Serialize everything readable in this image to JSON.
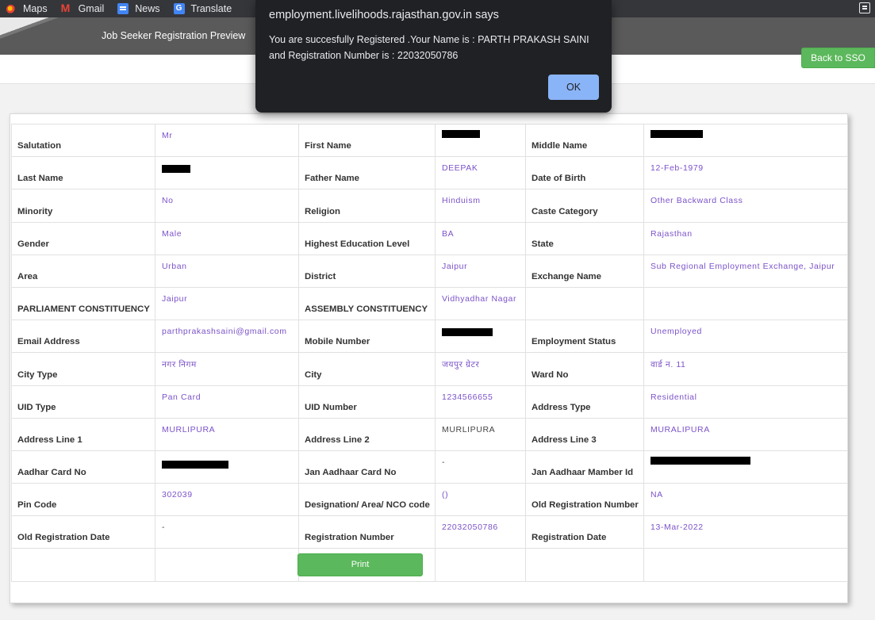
{
  "bookmarks": [
    {
      "label": "Maps",
      "icon": "maps-icon"
    },
    {
      "label": "Gmail",
      "icon": "gmail-icon"
    },
    {
      "label": "News",
      "icon": "news-icon"
    },
    {
      "label": "Translate",
      "icon": "translate-icon"
    }
  ],
  "header": {
    "title": "Job Seeker Registration Preview",
    "back_button": "Back to SSO"
  },
  "dialog": {
    "title": "employment.livelihoods.rajasthan.gov.in says",
    "message": "You are succesfully Registered .Your Name is  : PARTH PRAKASH SAINI\nand Registration Number is : 22032050786",
    "ok_label": "OK"
  },
  "form": {
    "rows": [
      [
        {
          "label": "Salutation",
          "value": "Mr"
        },
        {
          "label": "First Name",
          "value": "",
          "redacted": true
        },
        {
          "label": "Middle Name",
          "value": "",
          "redacted": true
        }
      ],
      [
        {
          "label": "Last Name",
          "value": "",
          "redacted": true
        },
        {
          "label": "Father Name",
          "value": "DEEPAK"
        },
        {
          "label": "Date of Birth",
          "value": "12-Feb-1979"
        }
      ],
      [
        {
          "label": "Minority",
          "value": "No"
        },
        {
          "label": "Religion",
          "value": "Hinduism"
        },
        {
          "label": "Caste Category",
          "value": "Other Backward Class"
        }
      ],
      [
        {
          "label": "Gender",
          "value": "Male"
        },
        {
          "label": "Highest Education Level",
          "value": "BA"
        },
        {
          "label": "State",
          "value": "Rajasthan"
        }
      ],
      [
        {
          "label": "Area",
          "value": "Urban"
        },
        {
          "label": "District",
          "value": "Jaipur"
        },
        {
          "label": "Exchange Name",
          "value": "Sub Regional Employment Exchange, Jaipur"
        }
      ],
      [
        {
          "label": "PARLIAMENT CONSTITUENCY",
          "value": "Jaipur"
        },
        {
          "label": "ASSEMBLY CONSTITUENCY",
          "value": "Vidhyadhar Nagar"
        },
        {
          "label": "",
          "value": ""
        }
      ],
      [
        {
          "label": "Email Address",
          "value": "parthprakashsaini@gmail.com"
        },
        {
          "label": "Mobile Number",
          "value": "",
          "redacted": true
        },
        {
          "label": "Employment Status",
          "value": "Unemployed"
        }
      ],
      [
        {
          "label": "City Type",
          "value": "नगर निगम"
        },
        {
          "label": "City",
          "value": "जयपुर ग्रेटर"
        },
        {
          "label": "Ward No",
          "value": "वार्ड न. 11"
        }
      ],
      [
        {
          "label": "UID Type",
          "value": "Pan Card"
        },
        {
          "label": "UID Number",
          "value": "1234566655"
        },
        {
          "label": "Address Type",
          "value": "Residential"
        }
      ],
      [
        {
          "label": "Address Line 1",
          "value": "MURLIPURA"
        },
        {
          "label": "Address Line 2",
          "value": "MURLIPURA",
          "plain": true
        },
        {
          "label": "Address Line 3",
          "value": "MURALIPURA"
        }
      ],
      [
        {
          "label": "Aadhar Card No",
          "value": "",
          "redacted": true
        },
        {
          "label": "Jan Aadhaar Card No",
          "value": "-",
          "plain": true
        },
        {
          "label": "Jan Aadhaar Mamber Id",
          "value": "",
          "redacted": true
        }
      ],
      [
        {
          "label": "Pin Code",
          "value": "302039"
        },
        {
          "label": "Designation/ Area/ NCO code",
          "value": "()"
        },
        {
          "label": "Old Registration Number",
          "value": "NA"
        }
      ],
      [
        {
          "label": "Old Registration Date",
          "value": "-",
          "plain": true
        },
        {
          "label": "Registration Number",
          "value": "22032050786"
        },
        {
          "label": "Registration Date",
          "value": "13-Mar-2022"
        }
      ]
    ],
    "print_label": "Print"
  }
}
